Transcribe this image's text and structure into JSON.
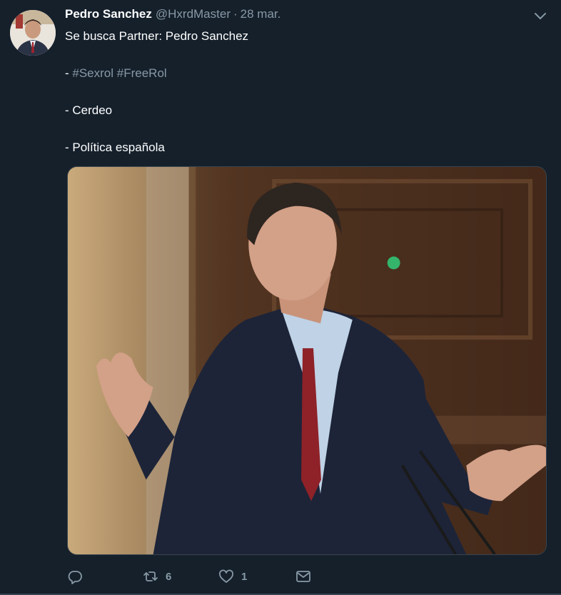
{
  "tweet": {
    "author_name": "Pedro Sanchez",
    "author_handle": "@HxrdMaster",
    "separator": "·",
    "date": "28 mar.",
    "lines": {
      "line1": "Se busca Partner: Pedro Sanchez",
      "line2_prefix": "- ",
      "hashtag1": "#Sexrol",
      "hashtag2": "#FreeRol",
      "line3": "- Cerdeo",
      "line4": "- Política española"
    },
    "media": {
      "description_icon": "photo"
    },
    "actions": {
      "reply_icon": "reply-icon",
      "retweet_icon": "retweet-icon",
      "retweet_count": "6",
      "like_icon": "heart-icon",
      "like_count": "1",
      "dm_icon": "envelope-icon"
    }
  },
  "colors": {
    "background": "#15202b",
    "muted": "#8899a6",
    "text": "#ffffff",
    "border": "#38444d"
  }
}
